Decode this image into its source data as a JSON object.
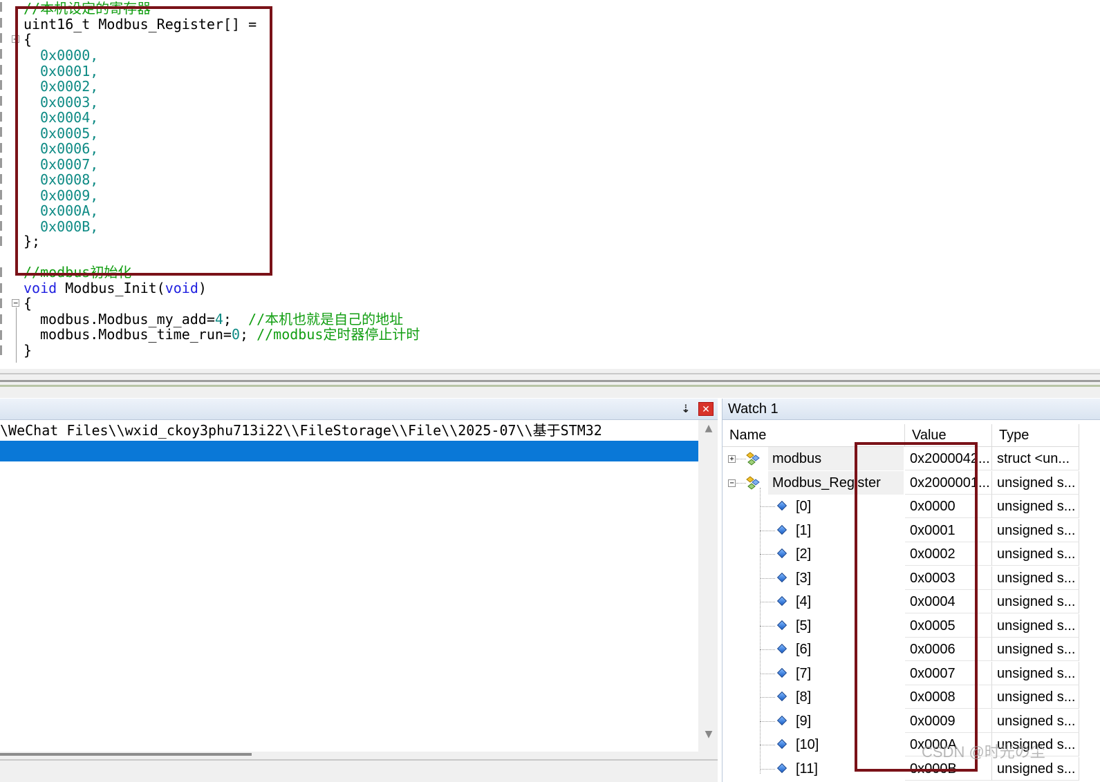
{
  "editor": {
    "lines": {
      "comment_registers": "//本机设定的寄存器",
      "decl": "uint16_t Modbus_Register[] =",
      "open_brace": "{",
      "values": [
        "0x0000,",
        "0x0001,",
        "0x0002,",
        "0x0003,",
        "0x0004,",
        "0x0005,",
        "0x0006,",
        "0x0007,",
        "0x0008,",
        "0x0009,",
        "0x000A,",
        "0x000B,"
      ],
      "close_brace": "};",
      "comment_init": "//modbus初始化",
      "void_kw": "void",
      "func_name": " Modbus_Init(",
      "void_param": "void",
      "close_paren": ")",
      "open_brace2": "{",
      "stmt1_code": "modbus.Modbus_my_add=",
      "stmt1_num": "4",
      "stmt1_semi": ";  ",
      "stmt1_comment": "//本机也就是自己的地址",
      "stmt2_code": "modbus.Modbus_time_run=",
      "stmt2_num": "0",
      "stmt2_semi": "; ",
      "stmt2_comment": "//modbus定时器停止计时",
      "close_brace2": "}"
    }
  },
  "output_pane": {
    "path_line": "\\WeChat Files\\\\wxid_ckoy3phu713i22\\\\FileStorage\\\\File\\\\2025-07\\\\基于STM32",
    "pin_icon": "pin-icon",
    "close_icon": "close-icon"
  },
  "watch": {
    "title": "Watch 1",
    "columns": {
      "name": "Name",
      "value": "Value",
      "type": "Type"
    },
    "rows": [
      {
        "name": "modbus",
        "value": "0x2000042...",
        "type": "struct <un...",
        "expand": "+"
      },
      {
        "name": "Modbus_Register",
        "value": "0x2000001...",
        "type": "unsigned s...",
        "expand": "−"
      },
      {
        "name": "[0]",
        "value": "0x0000",
        "type": "unsigned s..."
      },
      {
        "name": "[1]",
        "value": "0x0001",
        "type": "unsigned s..."
      },
      {
        "name": "[2]",
        "value": "0x0002",
        "type": "unsigned s..."
      },
      {
        "name": "[3]",
        "value": "0x0003",
        "type": "unsigned s..."
      },
      {
        "name": "[4]",
        "value": "0x0004",
        "type": "unsigned s..."
      },
      {
        "name": "[5]",
        "value": "0x0005",
        "type": "unsigned s..."
      },
      {
        "name": "[6]",
        "value": "0x0006",
        "type": "unsigned s..."
      },
      {
        "name": "[7]",
        "value": "0x0007",
        "type": "unsigned s..."
      },
      {
        "name": "[8]",
        "value": "0x0008",
        "type": "unsigned s..."
      },
      {
        "name": "[9]",
        "value": "0x0009",
        "type": "unsigned s..."
      },
      {
        "name": "[10]",
        "value": "0x000A",
        "type": "unsigned s..."
      },
      {
        "name": "[11]",
        "value": "0x000B",
        "type": "unsigned s..."
      }
    ]
  },
  "watermark": "CSDN @时光の尘",
  "colors": {
    "highlight_box": "#7a1218",
    "selection": "#0a78d7",
    "comment": "#119e11",
    "keyword": "#1f1fe0",
    "number": "#0d8a84"
  }
}
